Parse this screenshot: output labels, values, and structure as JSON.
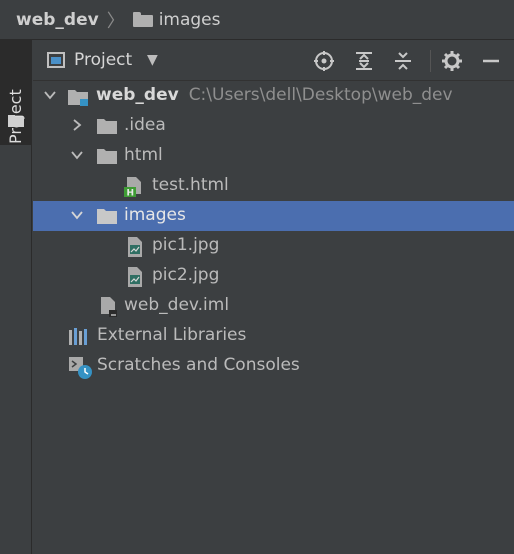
{
  "breadcrumb": {
    "project": "web_dev",
    "folder": "images"
  },
  "tool_window": {
    "stripe_label": "Project",
    "title": "Project"
  },
  "tree": {
    "root": {
      "name": "web_dev",
      "path": "C:\\Users\\dell\\Desktop\\web_dev"
    },
    "idea": ".idea",
    "html": "html",
    "test_html": "test.html",
    "images": "images",
    "pic1": "pic1.jpg",
    "pic2": "pic2.jpg",
    "iml": "web_dev.iml",
    "external_libraries": "External Libraries",
    "scratches": "Scratches and Consoles"
  },
  "colors": {
    "selection": "#4b6eaf",
    "background": "#3c3f41"
  },
  "icons": [
    "locate-icon",
    "expand-all-icon",
    "collapse-all-icon",
    "gear-icon",
    "minimize-icon"
  ]
}
